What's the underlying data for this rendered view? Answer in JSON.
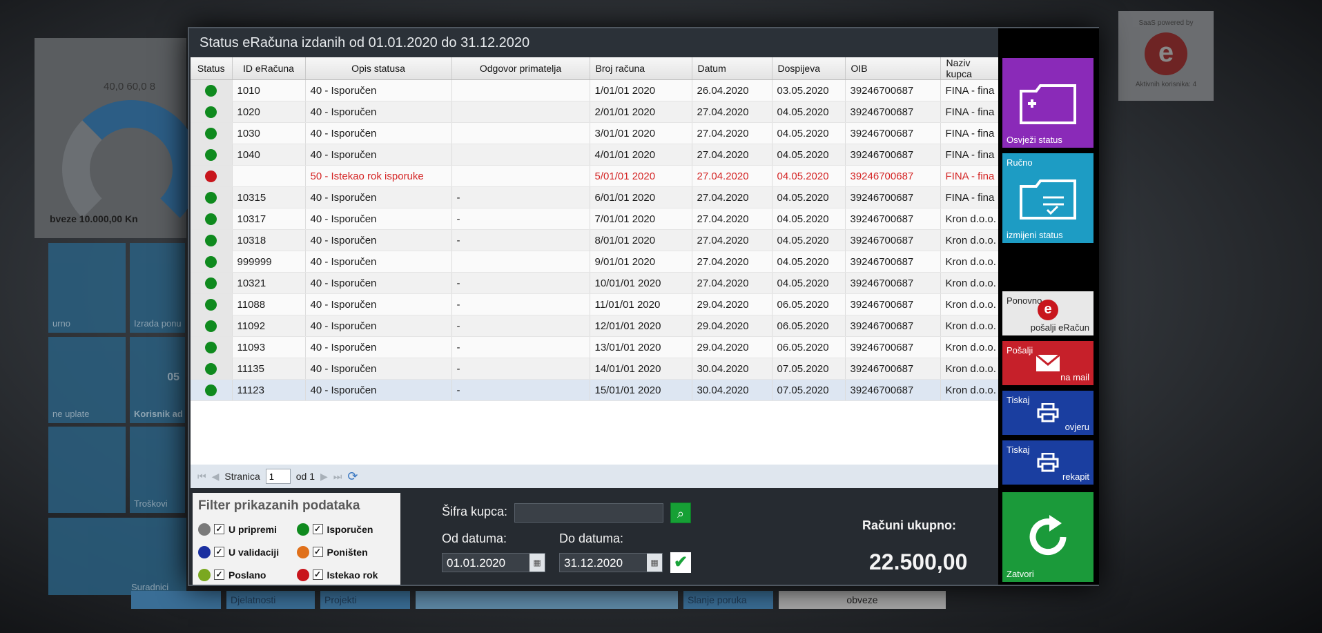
{
  "background": {
    "gauge_ticks": "40,0   60,0   8",
    "gauge_label": "bveze 10.000,00 Kn",
    "tiles": [
      "urno",
      "Izrada ponu",
      "ne uplate",
      "Korisnik ad",
      "Troškovi",
      "Suradnici"
    ],
    "tile_number": "05",
    "saas_label": "SaaS powered by",
    "saas_users": "Aktivnih korisnika: 4",
    "taskbar": [
      "Djelatnosti",
      "Projekti",
      "Slanje poruka",
      "obveze"
    ]
  },
  "window": {
    "title": "Status eRačuna izdanih od 01.01.2020 do 31.12.2020"
  },
  "grid": {
    "columns": [
      "Status",
      "ID eRačuna",
      "Opis statusa",
      "Odgovor primatelja",
      "Broj računa",
      "Datum",
      "Dospijeva",
      "OIB",
      "Naziv kupca"
    ],
    "rows": [
      {
        "status_color": "#0f8a1e",
        "id": "1010",
        "opis": "40 - Isporučen",
        "odgovor": "",
        "broj": "1/01/01 2020",
        "datum": "26.04.2020",
        "dospijeva": "03.05.2020",
        "oib": "39246700687",
        "kupac": "FINA - fina"
      },
      {
        "status_color": "#0f8a1e",
        "id": "1020",
        "opis": "40 - Isporučen",
        "odgovor": "",
        "broj": "2/01/01 2020",
        "datum": "27.04.2020",
        "dospijeva": "04.05.2020",
        "oib": "39246700687",
        "kupac": "FINA - fina"
      },
      {
        "status_color": "#0f8a1e",
        "id": "1030",
        "opis": "40 - Isporučen",
        "odgovor": "",
        "broj": "3/01/01 2020",
        "datum": "27.04.2020",
        "dospijeva": "04.05.2020",
        "oib": "39246700687",
        "kupac": "FINA - fina"
      },
      {
        "status_color": "#0f8a1e",
        "id": "1040",
        "opis": "40 - Isporučen",
        "odgovor": "",
        "broj": "4/01/01 2020",
        "datum": "27.04.2020",
        "dospijeva": "04.05.2020",
        "oib": "39246700687",
        "kupac": "FINA - fina"
      },
      {
        "status_color": "#c8161d",
        "id": "",
        "opis": "50 - Istekao rok isporuke",
        "odgovor": "",
        "broj": "5/01/01 2020",
        "datum": "27.04.2020",
        "dospijeva": "04.05.2020",
        "oib": "39246700687",
        "kupac": "FINA - fina"
      },
      {
        "status_color": "#0f8a1e",
        "id": "10315",
        "opis": "40 - Isporučen",
        "odgovor": "-",
        "broj": "6/01/01 2020",
        "datum": "27.04.2020",
        "dospijeva": "04.05.2020",
        "oib": "39246700687",
        "kupac": "FINA - fina"
      },
      {
        "status_color": "#0f8a1e",
        "id": "10317",
        "opis": "40 - Isporučen",
        "odgovor": "-",
        "broj": "7/01/01 2020",
        "datum": "27.04.2020",
        "dospijeva": "04.05.2020",
        "oib": "39246700687",
        "kupac": "Kron d.o.o."
      },
      {
        "status_color": "#0f8a1e",
        "id": "10318",
        "opis": "40 - Isporučen",
        "odgovor": "-",
        "broj": "8/01/01 2020",
        "datum": "27.04.2020",
        "dospijeva": "04.05.2020",
        "oib": "39246700687",
        "kupac": "Kron d.o.o."
      },
      {
        "status_color": "#0f8a1e",
        "id": "999999",
        "opis": "40 - Isporučen",
        "odgovor": "",
        "broj": "9/01/01 2020",
        "datum": "27.04.2020",
        "dospijeva": "04.05.2020",
        "oib": "39246700687",
        "kupac": "Kron d.o.o."
      },
      {
        "status_color": "#0f8a1e",
        "id": "10321",
        "opis": "40 - Isporučen",
        "odgovor": "-",
        "broj": "10/01/01 2020",
        "datum": "27.04.2020",
        "dospijeva": "04.05.2020",
        "oib": "39246700687",
        "kupac": "Kron d.o.o."
      },
      {
        "status_color": "#0f8a1e",
        "id": "11088",
        "opis": "40 - Isporučen",
        "odgovor": "-",
        "broj": "11/01/01 2020",
        "datum": "29.04.2020",
        "dospijeva": "06.05.2020",
        "oib": "39246700687",
        "kupac": "Kron d.o.o."
      },
      {
        "status_color": "#0f8a1e",
        "id": "11092",
        "opis": "40 - Isporučen",
        "odgovor": "-",
        "broj": "12/01/01 2020",
        "datum": "29.04.2020",
        "dospijeva": "06.05.2020",
        "oib": "39246700687",
        "kupac": "Kron d.o.o."
      },
      {
        "status_color": "#0f8a1e",
        "id": "11093",
        "opis": "40 - Isporučen",
        "odgovor": "-",
        "broj": "13/01/01 2020",
        "datum": "29.04.2020",
        "dospijeva": "06.05.2020",
        "oib": "39246700687",
        "kupac": "Kron d.o.o."
      },
      {
        "status_color": "#0f8a1e",
        "id": "11135",
        "opis": "40 - Isporučen",
        "odgovor": "-",
        "broj": "14/01/01 2020",
        "datum": "30.04.2020",
        "dospijeva": "07.05.2020",
        "oib": "39246700687",
        "kupac": "Kron d.o.o."
      },
      {
        "status_color": "#0f8a1e",
        "id": "11123",
        "opis": "40 - Isporučen",
        "odgovor": "-",
        "broj": "15/01/01 2020",
        "datum": "30.04.2020",
        "dospijeva": "07.05.2020",
        "oib": "39246700687",
        "kupac": "Kron d.o.o."
      }
    ],
    "selected_row": 14
  },
  "pager": {
    "label": "Stranica",
    "page": "1",
    "of": "od 1"
  },
  "filter": {
    "title": "Filter prikazanih podataka",
    "items": [
      {
        "label": "U pripremi",
        "color": "#7a7a7a",
        "checked": true
      },
      {
        "label": "Isporučen",
        "color": "#0f8a1e",
        "checked": true
      },
      {
        "label": "U validaciji",
        "color": "#1a2fa0",
        "checked": true
      },
      {
        "label": "Poništen",
        "color": "#e0701a",
        "checked": true
      },
      {
        "label": "Poslano",
        "color": "#7aa820",
        "checked": true
      },
      {
        "label": "Istekao rok",
        "color": "#c8161d",
        "checked": true
      }
    ]
  },
  "search": {
    "sifra_label": "Šifra kupca:",
    "sifra_value": "",
    "od_label": "Od datuma:",
    "od_value": "01.01.2020",
    "do_label": "Do datuma:",
    "do_value": "31.12.2020"
  },
  "totals": {
    "label": "Računi ukupno:",
    "value": "22.500,00"
  },
  "actions": [
    {
      "top": "",
      "bottom": "Osvježi status",
      "color": "#8a2ab8"
    },
    {
      "top": "Ručno",
      "bottom": "izmijeni status",
      "color": "#1d9cc4"
    },
    {
      "top": "Ponovno",
      "bottom": "pošalji eRačun",
      "color": "#e8e8e8"
    },
    {
      "top": "Pošalji",
      "bottom": "na mail",
      "color": "#c6202a"
    },
    {
      "top": "Tiskaj",
      "bottom": "ovjeru",
      "color": "#1a3ea0"
    },
    {
      "top": "Tiskaj",
      "bottom": "rekapit",
      "color": "#1a3ea0"
    },
    {
      "top": "",
      "bottom": "Zatvori",
      "color": "#1b9a3a"
    }
  ]
}
